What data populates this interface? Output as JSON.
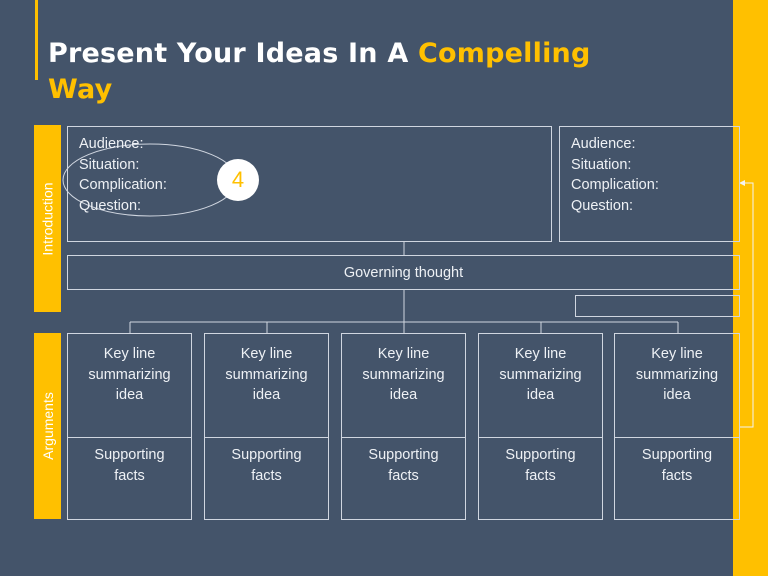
{
  "colors": {
    "background": "#44546a",
    "accent": "#ffc000",
    "line": "#d0d6e0",
    "text": "#eef1f5"
  },
  "title": {
    "part1": "Present Your Ideas In A ",
    "highlight1": "Compelling",
    "line2": "Way"
  },
  "sections": {
    "introduction": "Introduction",
    "arguments": "Arguments"
  },
  "intro_left": {
    "lines": [
      "Audience:",
      "Situation:",
      "Complication:",
      "Question:"
    ]
  },
  "intro_right": {
    "lines": [
      "Audience:",
      "Situation:",
      "Complication:",
      "Question:"
    ]
  },
  "step_badge": "4",
  "governing_thought": "Governing thought",
  "columns": [
    {
      "key_line": "Key line summarizing idea",
      "support": "Supporting facts"
    },
    {
      "key_line": "Key line summarizing idea",
      "support": "Supporting facts"
    },
    {
      "key_line": "Key line summarizing idea",
      "support": "Supporting facts"
    },
    {
      "key_line": "Key line summarizing idea",
      "support": "Supporting facts"
    },
    {
      "key_line": "Key line summarizing idea",
      "support": "Supporting facts"
    }
  ]
}
